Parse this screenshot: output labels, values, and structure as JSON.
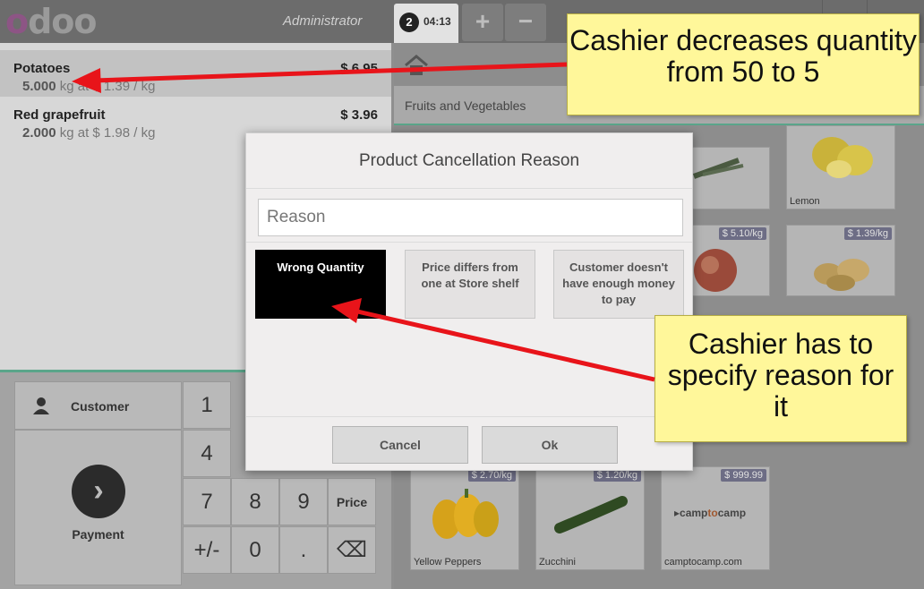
{
  "topbar": {
    "logo": "odoo",
    "user": "Administrator",
    "order_number": "2",
    "order_time": "04:13",
    "add_label": "+",
    "remove_label": "−"
  },
  "orderlines": [
    {
      "name": "Potatoes",
      "price": "$ 6.95",
      "qty": "5.000",
      "unit_info": "kg at $ 1.39 / kg",
      "selected": true
    },
    {
      "name": "Red grapefruit",
      "price": "$ 3.96",
      "qty": "2.000",
      "unit_info": "kg at $ 1.98 / kg",
      "selected": false
    }
  ],
  "actionpad": {
    "customer_label": "Customer",
    "payment_label": "Payment",
    "payment_icon": "chevron-right-icon"
  },
  "numpad": {
    "k1": "1",
    "k4": "4",
    "k7": "7",
    "k8": "8",
    "k9": "9",
    "price": "Price",
    "plusminus": "+/-",
    "k0": "0",
    "dot": ".",
    "backspace": "⌫"
  },
  "products": {
    "breadcrumb": "Fruits and Vegetables",
    "items": [
      {
        "name": "Lemon",
        "price": ""
      },
      {
        "name": "",
        "price": "$ 5.10/kg"
      },
      {
        "name": "",
        "price": "$ 1.39/kg"
      },
      {
        "name": "Yellow Peppers",
        "price": "$ 2.70/kg"
      },
      {
        "name": "Zucchini",
        "price": "$ 1.20/kg"
      },
      {
        "name": "camptocamp.com",
        "price": "$ 999.99"
      }
    ],
    "camp_logo_a": "camp",
    "camp_logo_b": "to",
    "camp_logo_c": "camp"
  },
  "modal": {
    "title": "Product Cancellation Reason",
    "reason_placeholder": "Reason",
    "choices": [
      "Wrong Quantity",
      "Price differs from one at Store shelf",
      "Customer doesn't have enough money to pay"
    ],
    "cancel_label": "Cancel",
    "ok_label": "Ok"
  },
  "annotations": {
    "note1": "Cashier decreases quantity from 50 to 5",
    "note2": "Cashier has to specify reason for it",
    "arrow_color": "#e8141a"
  }
}
